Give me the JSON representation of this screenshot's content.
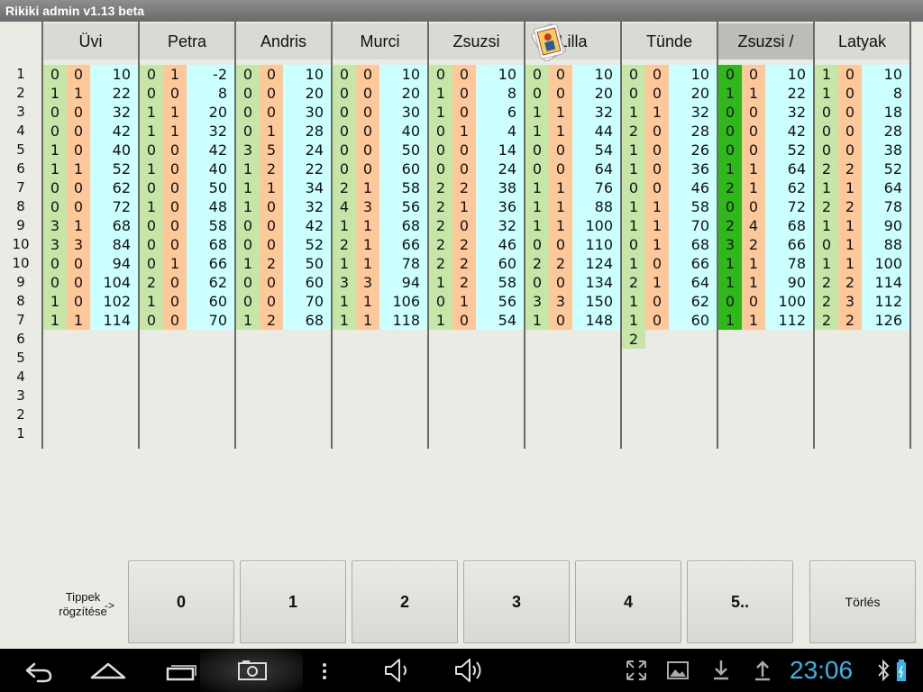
{
  "app": {
    "title": "Rikiki admin v1.13 beta"
  },
  "rounds": [
    "1",
    "2",
    "3",
    "4",
    "5",
    "6",
    "7",
    "8",
    "9",
    "10",
    "10",
    "9",
    "8",
    "7",
    "6",
    "5",
    "4",
    "3",
    "2",
    "1"
  ],
  "players": [
    {
      "name": "Üvi",
      "active": false,
      "bids": [
        "0",
        "1",
        "0",
        "0",
        "1",
        "1",
        "0",
        "0",
        "3",
        "3",
        "0",
        "0",
        "1",
        "1"
      ],
      "won": [
        "0",
        "1",
        "0",
        "0",
        "0",
        "1",
        "0",
        "0",
        "1",
        "3",
        "0",
        "0",
        "0",
        "1"
      ],
      "scores": [
        "10",
        "22",
        "32",
        "42",
        "40",
        "52",
        "62",
        "72",
        "68",
        "84",
        "94",
        "104",
        "102",
        "114"
      ]
    },
    {
      "name": "Petra",
      "active": false,
      "bids": [
        "0",
        "0",
        "1",
        "1",
        "0",
        "1",
        "0",
        "1",
        "0",
        "0",
        "0",
        "2",
        "1",
        "0"
      ],
      "won": [
        "1",
        "0",
        "1",
        "1",
        "0",
        "0",
        "0",
        "0",
        "0",
        "0",
        "1",
        "0",
        "0",
        "0"
      ],
      "scores": [
        "-2",
        "8",
        "20",
        "32",
        "42",
        "40",
        "50",
        "48",
        "58",
        "68",
        "66",
        "62",
        "60",
        "70"
      ]
    },
    {
      "name": "Andris",
      "active": false,
      "bids": [
        "0",
        "0",
        "0",
        "0",
        "3",
        "1",
        "1",
        "1",
        "0",
        "0",
        "1",
        "0",
        "0",
        "1"
      ],
      "won": [
        "0",
        "0",
        "0",
        "1",
        "5",
        "2",
        "1",
        "0",
        "0",
        "0",
        "2",
        "0",
        "0",
        "2"
      ],
      "scores": [
        "10",
        "20",
        "30",
        "28",
        "24",
        "22",
        "34",
        "32",
        "42",
        "52",
        "50",
        "60",
        "70",
        "68"
      ]
    },
    {
      "name": "Murci",
      "active": false,
      "bids": [
        "0",
        "0",
        "0",
        "0",
        "0",
        "0",
        "2",
        "4",
        "1",
        "2",
        "1",
        "3",
        "1",
        "1"
      ],
      "won": [
        "0",
        "0",
        "0",
        "0",
        "0",
        "0",
        "1",
        "3",
        "1",
        "1",
        "1",
        "3",
        "1",
        "1"
      ],
      "scores": [
        "10",
        "20",
        "30",
        "40",
        "50",
        "60",
        "58",
        "56",
        "68",
        "66",
        "78",
        "94",
        "106",
        "118"
      ]
    },
    {
      "name": "Zsuzsi",
      "active": false,
      "bids": [
        "0",
        "1",
        "1",
        "0",
        "0",
        "0",
        "2",
        "2",
        "2",
        "2",
        "2",
        "1",
        "0",
        "1"
      ],
      "won": [
        "0",
        "0",
        "0",
        "1",
        "0",
        "0",
        "2",
        "1",
        "0",
        "2",
        "2",
        "2",
        "1",
        "0"
      ],
      "scores": [
        "10",
        "8",
        "6",
        "4",
        "14",
        "24",
        "38",
        "36",
        "32",
        "46",
        "60",
        "58",
        "56",
        "54"
      ]
    },
    {
      "name": "Lilla",
      "active": false,
      "bids": [
        "0",
        "0",
        "1",
        "1",
        "0",
        "0",
        "1",
        "1",
        "1",
        "0",
        "2",
        "0",
        "3",
        "1"
      ],
      "won": [
        "0",
        "0",
        "1",
        "1",
        "0",
        "0",
        "1",
        "1",
        "1",
        "0",
        "2",
        "0",
        "3",
        "0"
      ],
      "scores": [
        "10",
        "20",
        "32",
        "44",
        "54",
        "64",
        "76",
        "88",
        "100",
        "110",
        "124",
        "134",
        "150",
        "148"
      ]
    },
    {
      "name": "Tünde",
      "active": false,
      "bids": [
        "0",
        "0",
        "1",
        "2",
        "1",
        "1",
        "0",
        "1",
        "1",
        "0",
        "1",
        "2",
        "1",
        "1",
        "2"
      ],
      "won": [
        "0",
        "0",
        "1",
        "0",
        "0",
        "0",
        "0",
        "1",
        "1",
        "1",
        "0",
        "1",
        "0",
        "0"
      ],
      "scores": [
        "10",
        "20",
        "32",
        "28",
        "26",
        "36",
        "46",
        "58",
        "70",
        "68",
        "66",
        "64",
        "62",
        "60"
      ]
    },
    {
      "name": "Zsuzsi /",
      "active": true,
      "bids": [
        "0",
        "1",
        "0",
        "0",
        "0",
        "1",
        "2",
        "0",
        "2",
        "3",
        "1",
        "1",
        "0",
        "1"
      ],
      "won": [
        "0",
        "1",
        "0",
        "0",
        "0",
        "1",
        "1",
        "0",
        "4",
        "2",
        "1",
        "1",
        "0",
        "1"
      ],
      "scores": [
        "10",
        "22",
        "32",
        "42",
        "52",
        "64",
        "62",
        "72",
        "68",
        "66",
        "78",
        "90",
        "100",
        "112"
      ]
    },
    {
      "name": "Latyak",
      "active": false,
      "bids": [
        "1",
        "1",
        "0",
        "0",
        "0",
        "2",
        "1",
        "2",
        "1",
        "0",
        "1",
        "2",
        "2",
        "2"
      ],
      "won": [
        "0",
        "0",
        "0",
        "0",
        "0",
        "2",
        "1",
        "2",
        "1",
        "1",
        "1",
        "2",
        "3",
        "2"
      ],
      "scores": [
        "10",
        "8",
        "18",
        "28",
        "38",
        "52",
        "64",
        "78",
        "90",
        "88",
        "100",
        "114",
        "112",
        "126"
      ]
    }
  ],
  "bottom": {
    "label_line1": "Tippek",
    "label_line2": "rögzítése",
    "arrow": "->",
    "buttons": [
      "0",
      "1",
      "2",
      "3",
      "4",
      "5.."
    ],
    "clear_label": "Törlés"
  },
  "navbar": {
    "icons": [
      "back-icon",
      "home-icon",
      "recent-apps-icon",
      "camera-icon",
      "menu-dots-icon",
      "volume-down-icon",
      "volume-up-icon",
      "fullscreen-icon",
      "gallery-icon",
      "download-icon",
      "upload-icon",
      "bluetooth-icon",
      "battery-icon"
    ],
    "clock": "23:06",
    "clock_color": "#33b5e5"
  },
  "colors": {
    "bid": "#c5e6a7",
    "bid_active": "#2eb819",
    "won": "#ffc89a",
    "score": "#ccffff"
  }
}
